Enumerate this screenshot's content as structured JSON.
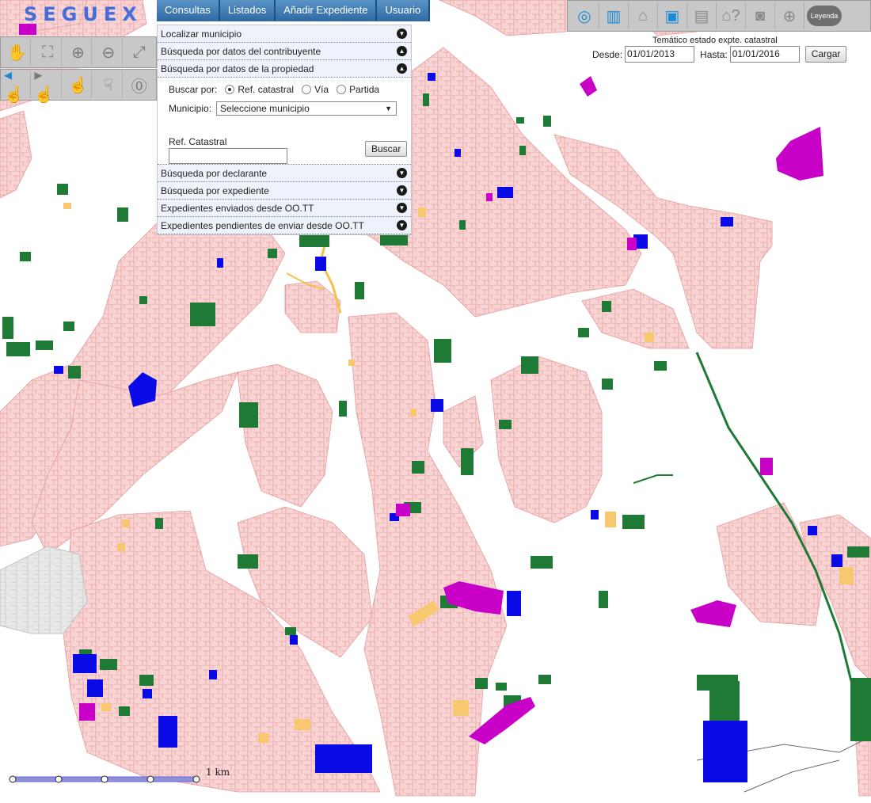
{
  "app": {
    "logo_text": "SEGUEX"
  },
  "menu": [
    "Consultas",
    "Listados",
    "Añadir Expediente",
    "Usuario"
  ],
  "left_tools": {
    "row1": [
      "pan-hand-icon",
      "zoom-extent-icon",
      "zoom-in-icon",
      "zoom-out-icon",
      "full-extent-icon"
    ],
    "row2": [
      "previous-view-icon",
      "next-view-icon",
      "select-hand-icon",
      "identify-hand-icon",
      "info-icon"
    ]
  },
  "panel": {
    "sections_top": [
      {
        "label": "Localizar municipio",
        "state": "collapsed"
      },
      {
        "label": "Búsqueda por datos del contribuyente",
        "state": "expanded"
      },
      {
        "label": "Búsqueda por datos de la propiedad",
        "state": "expanded"
      }
    ],
    "property_search": {
      "buscar_por_label": "Buscar por:",
      "options": [
        "Ref. catastral",
        "Vía",
        "Partida"
      ],
      "selected_option": "Ref. catastral",
      "municipio_label": "Municipio:",
      "municipio_value": "Seleccione municipio",
      "ref_label": "Ref. Catastral",
      "ref_value": "",
      "search_button": "Buscar"
    },
    "sections_bottom": [
      {
        "label": "Búsqueda por declarante",
        "state": "collapsed"
      },
      {
        "label": "Búsqueda por expediente",
        "state": "collapsed"
      },
      {
        "label": "Expedientes enviados desde OO.TT",
        "state": "collapsed"
      },
      {
        "label": "Expedientes pendientes de enviar desde OO.TT",
        "state": "collapsed"
      }
    ]
  },
  "right_tools": [
    "layers-target-icon",
    "building-icon",
    "house-icon",
    "id-card-icon",
    "document-icon",
    "house-question-icon",
    "camera-icon",
    "globe-icon"
  ],
  "legend_button": "Leyenda",
  "thematic": {
    "title": "Temático estado expte. catastral",
    "desde_label": "Desde:",
    "desde_value": "01/01/2013",
    "hasta_label": "Hasta:",
    "hasta_value": "01/01/2016",
    "load_button": "Cargar"
  },
  "scale": {
    "label": "1 km"
  },
  "colors": {
    "parcel_fill": "#f9d4d4",
    "parcel_stroke": "#e69a9a",
    "status_green": "#1e7a34",
    "status_blue": "#0a0ae6",
    "status_magenta": "#c800c8",
    "status_yellow": "#f8c870",
    "other_municipality": "#e6e6e6"
  }
}
